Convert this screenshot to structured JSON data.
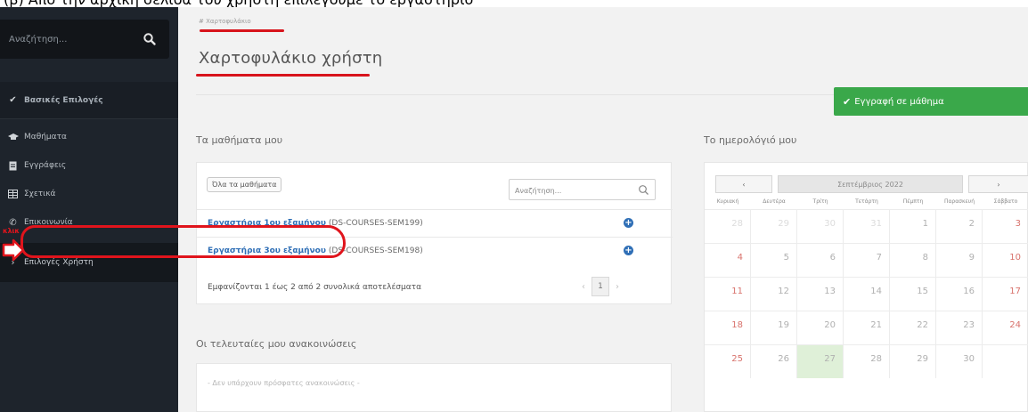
{
  "top_strip_text": "(β) Από την αρχική σελίδα του χρήστη επιλέγουμε το εργαστήριο",
  "sidebar": {
    "search_placeholder": "Αναζήτηση...",
    "basic_label": "Βασικές Επιλογές",
    "items": [
      {
        "label": "Μαθήματα",
        "icon": "graduation-cap-icon"
      },
      {
        "label": "Εγγράφεις",
        "icon": "document-icon"
      },
      {
        "label": "Σχετικά",
        "icon": "grid-icon"
      },
      {
        "label": "Επικοινωνία",
        "icon": "phone-icon"
      }
    ],
    "user_label": "Επιλογές Χρήστη"
  },
  "main": {
    "breadcrumb": "# Χαρτοφυλάκιο",
    "title": "Χαρτοφυλάκιο χρήστη",
    "enroll_button": "Εγγραφή σε μάθημα"
  },
  "courses": {
    "heading": "Τα μαθήματα μου",
    "all_button": "Όλα τα μαθήματα",
    "search_placeholder": "Αναζήτηση...",
    "rows": [
      {
        "name": "Εργαστήρια 1ου εξαμήνου",
        "code": "(DS-COURSES-SEM199)"
      },
      {
        "name": "Εργαστήρια 3ου εξαμήνου",
        "code": "(DS-COURSES-SEM198)"
      }
    ],
    "results_text": "Εμφανίζονται 1 έως 2 από 2 συνολικά αποτελέσματα",
    "current_page": "1",
    "prev": "‹",
    "next": "›"
  },
  "annotation": {
    "click_label": "κλικ",
    "color": "#e0141c"
  },
  "announcements": {
    "heading": "Οι τελευταίες μου ανακοινώσεις",
    "empty_text": "- Δεν υπάρχουν πρόσφατες ανακοινώσεις -"
  },
  "calendar": {
    "heading": "Το ημερολόγιό μου",
    "month": "Σεπτέμβριος 2022",
    "prev": "‹",
    "next": "›",
    "days": [
      "Κυριακή",
      "Δευτέρα",
      "Τρίτη",
      "Τετάρτη",
      "Πέμπτη",
      "Παρασκευή",
      "Σάββατο"
    ],
    "weeks": [
      [
        "28",
        "29",
        "30",
        "31",
        "1",
        "2",
        "3"
      ],
      [
        "4",
        "5",
        "6",
        "7",
        "8",
        "9",
        "10"
      ],
      [
        "11",
        "12",
        "13",
        "14",
        "15",
        "16",
        "17"
      ],
      [
        "18",
        "19",
        "20",
        "21",
        "22",
        "23",
        "24"
      ],
      [
        "25",
        "26",
        "27",
        "28",
        "29",
        "30",
        ""
      ]
    ],
    "today": "27"
  },
  "colors": {
    "accent_green": "#3aa84a",
    "link_blue": "#2f6fb6",
    "sidebar_bg": "#1e242c"
  }
}
